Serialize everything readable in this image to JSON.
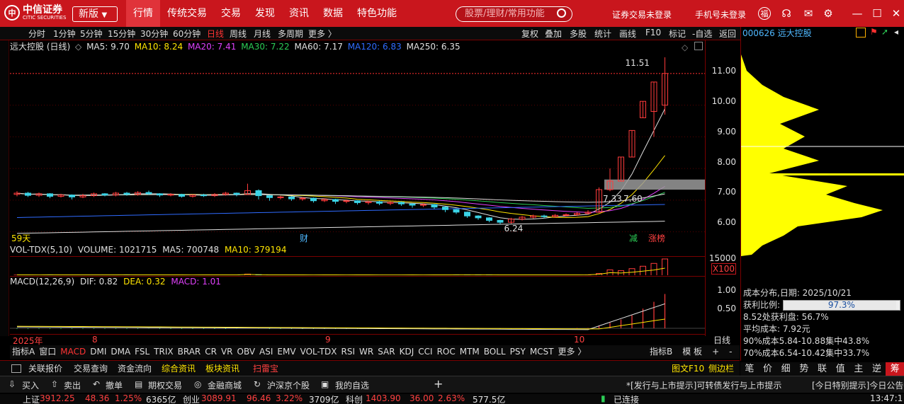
{
  "topbar": {
    "logo_text": "中信证券",
    "logo_sub": "CITIC SECURITIES",
    "version": "新版",
    "menu": [
      "行情",
      "传统交易",
      "交易",
      "发现",
      "资讯",
      "数据",
      "特色功能"
    ],
    "search_placeholder": "股票/理财/常用功能",
    "broker_login": "证券交易未登录",
    "phone_login": "手机号未登录"
  },
  "toolbar": {
    "periods": [
      "分时",
      "1分钟",
      "5分钟",
      "15分钟",
      "30分钟",
      "60分钟",
      "日线",
      "周线",
      "月线",
      "多周期",
      "更多 〉"
    ],
    "selected_period": "日线",
    "right": [
      "复权",
      "叠加",
      "多股",
      "统计",
      "画线",
      "F10",
      "标记",
      "-自选",
      "返回"
    ]
  },
  "stock": {
    "code_name": "000626 远大控股"
  },
  "chart_header": {
    "name": "远大控股 (日线)",
    "ma5": "MA5: 9.70",
    "ma10": "MA10: 8.24",
    "ma20": "MA20: 7.41",
    "ma30": "MA30: 7.22",
    "ma60": "MA60: 7.17",
    "ma120": "MA120: 6.83",
    "ma250": "MA250: 6.35"
  },
  "price_axis": [
    "11.00",
    "10.00",
    "9.00",
    "8.00",
    "7.00",
    "6.00"
  ],
  "annotations": {
    "high": "11.51",
    "low": "6.24",
    "a": "7.33",
    "b": "7.60",
    "days": "59天",
    "cai": "财",
    "jian": "减",
    "zhangbang": "涨榜"
  },
  "volume": {
    "header": "VOL-TDX(5,10)",
    "volume": "VOLUME: 1021715",
    "ma5": "MA5: 700748",
    "ma10": "MA10: 379194",
    "axis_top": "15000",
    "axis_unit": "X100"
  },
  "macd": {
    "header": "MACD(12,26,9)",
    "dif": "DIF: 0.82",
    "dea": "DEA: 0.32",
    "macd": "MACD: 1.01",
    "axis": [
      "1.00",
      "0.50"
    ]
  },
  "x_axis": {
    "labels": [
      "2025年",
      "8",
      "9",
      "10"
    ],
    "period": "日线"
  },
  "indicator_tabs": [
    "指标A",
    "窗口",
    "MACD",
    "DMI",
    "DMA",
    "FSL",
    "TRIX",
    "BRAR",
    "CR",
    "VR",
    "OBV",
    "ASI",
    "EMV",
    "VOL-TDX",
    "RSI",
    "WR",
    "SAR",
    "KDJ",
    "CCI",
    "ROC",
    "MTM",
    "BOLL",
    "PSY",
    "MCST",
    "更多 〉"
  ],
  "indicator_selected": "MACD",
  "indicator_right": [
    "指标B",
    "模 板",
    "+",
    "-"
  ],
  "bottom_tabs": [
    "关联报价",
    "交易查询",
    "资金流向",
    "综合资讯",
    "板块资讯",
    "扫雷宝"
  ],
  "bottom_right": [
    "图文F10",
    "侧边栏"
  ],
  "cost": {
    "title": "成本分布,日期: 2025/10/21",
    "profit_label": "获利比例:",
    "profit": "97.3%",
    "profit_fraction": 0.973,
    "line1": "8.52处获利盘: 56.7%",
    "line2": "平均成本: 7.92元",
    "line3": "90%成本5.84-10.88集中43.8%",
    "line4": "70%成本6.54-10.42集中33.7%"
  },
  "right_tabs": [
    "笔",
    "价",
    "细",
    "势",
    "联",
    "值",
    "主",
    "逆",
    "筹"
  ],
  "right_selected": "筹",
  "quickbar": {
    "items": [
      "买入",
      "卖出",
      "撤单",
      "期权交易",
      "金融商城",
      "沪深京个股",
      "我的自选"
    ],
    "notice1": "*[发行与上市提示]可转债发行与上市提示",
    "notice2": "[今日特别提示]今日公告提"
  },
  "status": {
    "sh_label": "上证",
    "sh": "3912.25",
    "sh_chg": "48.36",
    "sh_pct": "1.25%",
    "sh_amt": "6365亿",
    "cy_label": "创业",
    "cy": "3089.91",
    "cy_chg": "96.46",
    "cy_pct": "3.22%",
    "cy_amt": "3709亿",
    "kc_label": "科创",
    "kc": "1403.90",
    "kc_chg": "36.00",
    "kc_pct": "2.63%",
    "kc_amt": "577.5亿",
    "conn": "已连接",
    "time": "13:47:1"
  },
  "colors": {
    "brand": "#c9161d",
    "up": "#ff4040",
    "down": "#2ccc55",
    "ma5": "#e0e0e0",
    "ma10": "#ffe500",
    "ma20": "#e040fb",
    "ma30": "#2ccc55",
    "ma120": "#2f6bff"
  },
  "chart_data": {
    "type": "candlestick",
    "ylim": [
      5.7,
      11.6
    ],
    "candles": [
      {
        "o": 7.18,
        "c": 7.22,
        "h": 7.28,
        "l": 7.12
      },
      {
        "o": 7.22,
        "c": 7.15,
        "h": 7.26,
        "l": 7.1
      },
      {
        "o": 7.15,
        "c": 7.2,
        "h": 7.24,
        "l": 7.1
      },
      {
        "o": 7.2,
        "c": 7.12,
        "h": 7.22,
        "l": 7.06
      },
      {
        "o": 7.12,
        "c": 7.16,
        "h": 7.2,
        "l": 7.08
      },
      {
        "o": 7.16,
        "c": 7.1,
        "h": 7.18,
        "l": 7.02
      },
      {
        "o": 7.1,
        "c": 7.14,
        "h": 7.2,
        "l": 7.06
      },
      {
        "o": 7.14,
        "c": 7.2,
        "h": 7.24,
        "l": 7.1
      },
      {
        "o": 7.2,
        "c": 7.16,
        "h": 7.22,
        "l": 7.12
      },
      {
        "o": 7.16,
        "c": 7.22,
        "h": 7.26,
        "l": 7.12
      },
      {
        "o": 7.22,
        "c": 7.18,
        "h": 7.26,
        "l": 7.14
      },
      {
        "o": 7.18,
        "c": 7.24,
        "h": 7.28,
        "l": 7.14
      },
      {
        "o": 7.24,
        "c": 7.2,
        "h": 7.3,
        "l": 7.16
      },
      {
        "o": 7.2,
        "c": 7.16,
        "h": 7.22,
        "l": 7.1
      },
      {
        "o": 7.16,
        "c": 7.18,
        "h": 7.22,
        "l": 7.12
      },
      {
        "o": 7.18,
        "c": 7.12,
        "h": 7.2,
        "l": 7.08
      },
      {
        "o": 7.12,
        "c": 7.16,
        "h": 7.18,
        "l": 7.08
      },
      {
        "o": 7.16,
        "c": 7.14,
        "h": 7.2,
        "l": 7.1
      },
      {
        "o": 7.14,
        "c": 7.18,
        "h": 7.22,
        "l": 7.1
      },
      {
        "o": 7.18,
        "c": 7.22,
        "h": 7.26,
        "l": 7.14
      },
      {
        "o": 7.22,
        "c": 7.18,
        "h": 7.24,
        "l": 7.12
      },
      {
        "o": 7.18,
        "c": 7.3,
        "h": 7.52,
        "l": 7.16
      },
      {
        "o": 7.3,
        "c": 7.14,
        "h": 7.34,
        "l": 7.02
      },
      {
        "o": 7.14,
        "c": 7.08,
        "h": 7.16,
        "l": 6.98
      },
      {
        "o": 7.08,
        "c": 7.1,
        "h": 7.14,
        "l": 7.02
      },
      {
        "o": 7.1,
        "c": 7.04,
        "h": 7.12,
        "l": 6.98
      },
      {
        "o": 7.04,
        "c": 7.06,
        "h": 7.1,
        "l": 6.98
      },
      {
        "o": 7.06,
        "c": 6.98,
        "h": 7.08,
        "l": 6.92
      },
      {
        "o": 6.98,
        "c": 7.02,
        "h": 7.06,
        "l": 6.94
      },
      {
        "o": 7.02,
        "c": 6.96,
        "h": 7.04,
        "l": 6.88
      },
      {
        "o": 6.96,
        "c": 6.98,
        "h": 7.02,
        "l": 6.9
      },
      {
        "o": 6.98,
        "c": 6.92,
        "h": 7.0,
        "l": 6.86
      },
      {
        "o": 6.92,
        "c": 6.95,
        "h": 6.98,
        "l": 6.86
      },
      {
        "o": 6.95,
        "c": 6.9,
        "h": 6.98,
        "l": 6.84
      },
      {
        "o": 6.9,
        "c": 6.93,
        "h": 6.96,
        "l": 6.84
      },
      {
        "o": 6.93,
        "c": 6.88,
        "h": 6.96,
        "l": 6.82
      },
      {
        "o": 6.88,
        "c": 6.84,
        "h": 6.9,
        "l": 6.76
      },
      {
        "o": 6.84,
        "c": 6.86,
        "h": 6.9,
        "l": 6.78
      },
      {
        "o": 6.86,
        "c": 6.78,
        "h": 6.88,
        "l": 6.72
      },
      {
        "o": 6.78,
        "c": 6.7,
        "h": 6.8,
        "l": 6.62
      },
      {
        "o": 6.7,
        "c": 6.62,
        "h": 6.72,
        "l": 6.56
      },
      {
        "o": 6.62,
        "c": 6.5,
        "h": 6.64,
        "l": 6.44
      },
      {
        "o": 6.5,
        "c": 6.44,
        "h": 6.52,
        "l": 6.38
      },
      {
        "o": 6.44,
        "c": 6.36,
        "h": 6.46,
        "l": 6.3
      },
      {
        "o": 6.36,
        "c": 6.3,
        "h": 6.38,
        "l": 6.24
      },
      {
        "o": 6.3,
        "c": 6.4,
        "h": 6.44,
        "l": 6.26
      },
      {
        "o": 6.4,
        "c": 6.46,
        "h": 6.5,
        "l": 6.36
      },
      {
        "o": 6.46,
        "c": 6.5,
        "h": 6.54,
        "l": 6.42
      },
      {
        "o": 6.5,
        "c": 6.48,
        "h": 6.54,
        "l": 6.42
      },
      {
        "o": 6.48,
        "c": 6.52,
        "h": 6.56,
        "l": 6.44
      },
      {
        "o": 6.52,
        "c": 6.54,
        "h": 6.58,
        "l": 6.48
      },
      {
        "o": 6.54,
        "c": 6.58,
        "h": 6.62,
        "l": 6.5
      },
      {
        "o": 6.58,
        "c": 6.62,
        "h": 6.68,
        "l": 6.54
      },
      {
        "o": 6.62,
        "c": 7.33,
        "h": 7.4,
        "l": 6.6
      },
      {
        "o": 7.33,
        "c": 7.6,
        "h": 8.0,
        "l": 7.28
      },
      {
        "o": 7.6,
        "c": 8.36,
        "h": 8.36,
        "l": 7.6
      },
      {
        "o": 8.36,
        "c": 9.2,
        "h": 9.2,
        "l": 8.36
      },
      {
        "o": 9.6,
        "c": 10.12,
        "h": 10.12,
        "l": 9.6
      },
      {
        "o": 9.8,
        "c": 10.73,
        "h": 10.73,
        "l": 9.0
      },
      {
        "o": 10.0,
        "c": 11.0,
        "h": 11.51,
        "l": 9.7
      }
    ],
    "volume": [
      20,
      22,
      18,
      24,
      20,
      19,
      21,
      23,
      20,
      22,
      24,
      21,
      20,
      19,
      22,
      20,
      18,
      21,
      23,
      22,
      20,
      45,
      30,
      22,
      20,
      19,
      21,
      18,
      20,
      19,
      18,
      20,
      19,
      18,
      17,
      18,
      19,
      18,
      20,
      22,
      24,
      26,
      25,
      24,
      23,
      22,
      21,
      22,
      20,
      21,
      22,
      23,
      24,
      60,
      150,
      130,
      180,
      240,
      310,
      420
    ],
    "macd_bars": [
      -0.02,
      -0.02,
      -0.02,
      -0.02,
      -0.02,
      -0.02,
      -0.02,
      -0.02,
      -0.02,
      -0.02,
      -0.02,
      -0.02,
      -0.01,
      -0.02,
      -0.02,
      -0.02,
      -0.02,
      -0.02,
      -0.02,
      -0.02,
      -0.01,
      0.01,
      -0.01,
      -0.02,
      -0.02,
      -0.02,
      -0.02,
      -0.02,
      -0.02,
      -0.02,
      -0.02,
      -0.02,
      -0.02,
      -0.02,
      -0.02,
      -0.02,
      -0.02,
      -0.02,
      -0.02,
      -0.02,
      -0.02,
      -0.03,
      -0.03,
      -0.03,
      -0.03,
      -0.02,
      -0.02,
      -0.01,
      -0.01,
      0.0,
      0.0,
      0.01,
      0.01,
      0.08,
      0.16,
      0.26,
      0.38,
      0.58,
      0.78,
      1.01
    ]
  }
}
